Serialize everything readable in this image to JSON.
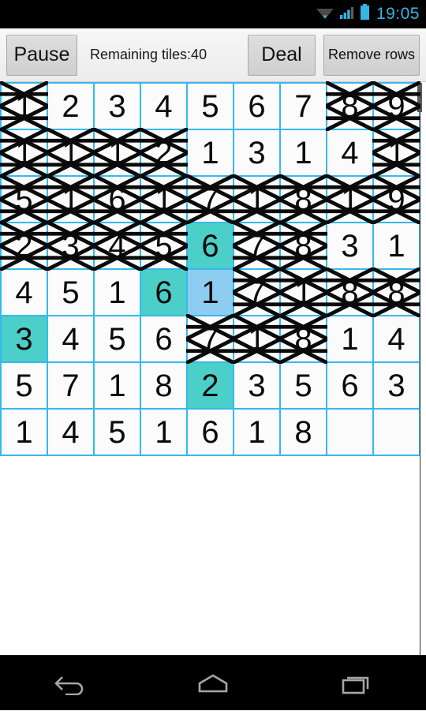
{
  "status_bar": {
    "time": "19:05",
    "icons": [
      "wifi-icon",
      "cellular-signal-icon",
      "battery-icon"
    ],
    "accent_color": "#33B5E5"
  },
  "toolbar": {
    "pause_label": "Pause",
    "remaining_label": "Remaining tiles:40",
    "deal_label": "Deal",
    "remove_rows_label": "Remove rows"
  },
  "colors": {
    "grid_line": "#35B9EE",
    "tile_bg": "#FBFBFB",
    "highlight_teal": "#4CCFC8",
    "selected_blue": "#8DCDF0",
    "text": "#0A0A0A"
  },
  "board": {
    "columns": 9,
    "rows": 8,
    "cells": [
      [
        {
          "value": "1",
          "state": "crossed"
        },
        {
          "value": "2",
          "state": "normal"
        },
        {
          "value": "3",
          "state": "normal"
        },
        {
          "value": "4",
          "state": "normal"
        },
        {
          "value": "5",
          "state": "normal"
        },
        {
          "value": "6",
          "state": "normal"
        },
        {
          "value": "7",
          "state": "normal"
        },
        {
          "value": "8",
          "state": "crossed"
        },
        {
          "value": "9",
          "state": "crossed"
        }
      ],
      [
        {
          "value": "1",
          "state": "crossed"
        },
        {
          "value": "1",
          "state": "crossed"
        },
        {
          "value": "1",
          "state": "crossed"
        },
        {
          "value": "2",
          "state": "crossed"
        },
        {
          "value": "1",
          "state": "normal"
        },
        {
          "value": "3",
          "state": "normal"
        },
        {
          "value": "1",
          "state": "normal"
        },
        {
          "value": "4",
          "state": "normal"
        },
        {
          "value": "1",
          "state": "crossed"
        }
      ],
      [
        {
          "value": "5",
          "state": "crossed"
        },
        {
          "value": "1",
          "state": "crossed"
        },
        {
          "value": "6",
          "state": "crossed"
        },
        {
          "value": "1",
          "state": "crossed"
        },
        {
          "value": "7",
          "state": "crossed"
        },
        {
          "value": "1",
          "state": "crossed"
        },
        {
          "value": "8",
          "state": "crossed"
        },
        {
          "value": "1",
          "state": "crossed"
        },
        {
          "value": "9",
          "state": "crossed"
        }
      ],
      [
        {
          "value": "2",
          "state": "crossed"
        },
        {
          "value": "3",
          "state": "crossed"
        },
        {
          "value": "4",
          "state": "crossed"
        },
        {
          "value": "5",
          "state": "crossed"
        },
        {
          "value": "6",
          "state": "teal"
        },
        {
          "value": "7",
          "state": "crossed"
        },
        {
          "value": "8",
          "state": "crossed"
        },
        {
          "value": "3",
          "state": "normal"
        },
        {
          "value": "1",
          "state": "normal"
        }
      ],
      [
        {
          "value": "4",
          "state": "normal"
        },
        {
          "value": "5",
          "state": "normal"
        },
        {
          "value": "1",
          "state": "normal"
        },
        {
          "value": "6",
          "state": "teal"
        },
        {
          "value": "1",
          "state": "selected"
        },
        {
          "value": "7",
          "state": "crossed"
        },
        {
          "value": "1",
          "state": "crossed"
        },
        {
          "value": "8",
          "state": "crossed"
        },
        {
          "value": "8",
          "state": "crossed"
        }
      ],
      [
        {
          "value": "3",
          "state": "teal"
        },
        {
          "value": "4",
          "state": "normal"
        },
        {
          "value": "5",
          "state": "normal"
        },
        {
          "value": "6",
          "state": "normal"
        },
        {
          "value": "7",
          "state": "crossed"
        },
        {
          "value": "1",
          "state": "crossed"
        },
        {
          "value": "8",
          "state": "crossed"
        },
        {
          "value": "1",
          "state": "normal"
        },
        {
          "value": "4",
          "state": "normal"
        }
      ],
      [
        {
          "value": "5",
          "state": "normal"
        },
        {
          "value": "7",
          "state": "normal"
        },
        {
          "value": "1",
          "state": "normal"
        },
        {
          "value": "8",
          "state": "normal"
        },
        {
          "value": "2",
          "state": "teal"
        },
        {
          "value": "3",
          "state": "normal"
        },
        {
          "value": "5",
          "state": "normal"
        },
        {
          "value": "6",
          "state": "normal"
        },
        {
          "value": "3",
          "state": "normal"
        }
      ],
      [
        {
          "value": "1",
          "state": "normal"
        },
        {
          "value": "4",
          "state": "normal"
        },
        {
          "value": "5",
          "state": "normal"
        },
        {
          "value": "1",
          "state": "normal"
        },
        {
          "value": "6",
          "state": "normal"
        },
        {
          "value": "1",
          "state": "normal"
        },
        {
          "value": "8",
          "state": "normal"
        },
        {
          "value": "",
          "state": "empty"
        },
        {
          "value": "",
          "state": "empty"
        }
      ]
    ]
  },
  "nav_bar": {
    "back_label": "back-icon",
    "home_label": "home-icon",
    "recents_label": "recents-icon"
  }
}
